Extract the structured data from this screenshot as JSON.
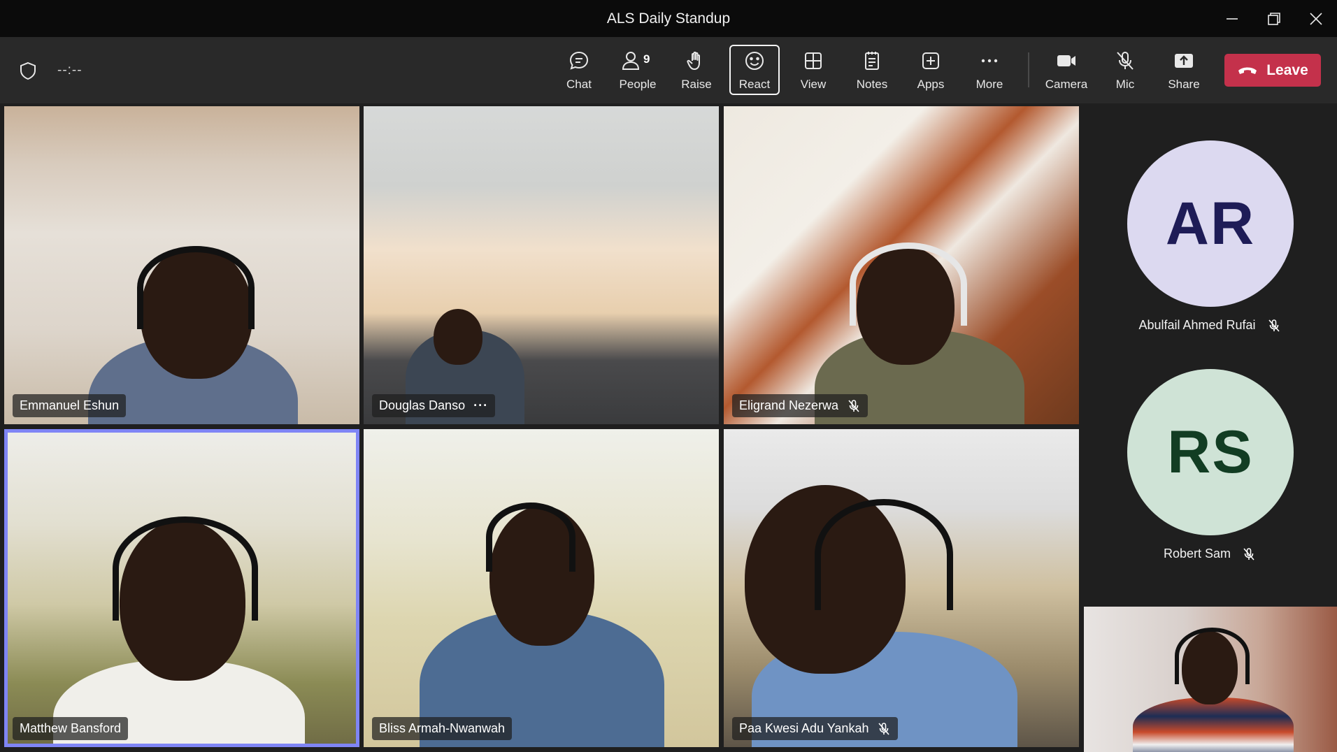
{
  "window": {
    "title": "ALS Daily Standup"
  },
  "toolbar": {
    "timer": "--:--",
    "buttons": {
      "chat": "Chat",
      "people": "People",
      "people_count": "9",
      "raise": "Raise",
      "react": "React",
      "view": "View",
      "notes": "Notes",
      "apps": "Apps",
      "more": "More",
      "camera": "Camera",
      "mic": "Mic",
      "share": "Share"
    },
    "leave": "Leave",
    "leave_color": "#c4314b"
  },
  "participants": [
    {
      "name": "Emmanuel Eshun",
      "muted": false
    },
    {
      "name": "Douglas Danso",
      "muted": false,
      "more_options": "···"
    },
    {
      "name": "Eligrand Nezerwa",
      "muted": true
    },
    {
      "name": "Matthew Bansford",
      "muted": false,
      "active_speaker": true
    },
    {
      "name": "Bliss Armah-Nwanwah",
      "muted": false
    },
    {
      "name": "Paa Kwesi Adu Yankah",
      "muted": true
    }
  ],
  "rail": [
    {
      "initials": "AR",
      "name": "Abulfail Ahmed Rufai",
      "muted": true,
      "bg": "#dcd9f0",
      "fg": "#1e1c57"
    },
    {
      "initials": "RS",
      "name": "Robert Sam",
      "muted": true,
      "bg": "#cfe3d6",
      "fg": "#123d23"
    }
  ],
  "colors": {
    "active_speaker_border": "#7f85f5"
  }
}
